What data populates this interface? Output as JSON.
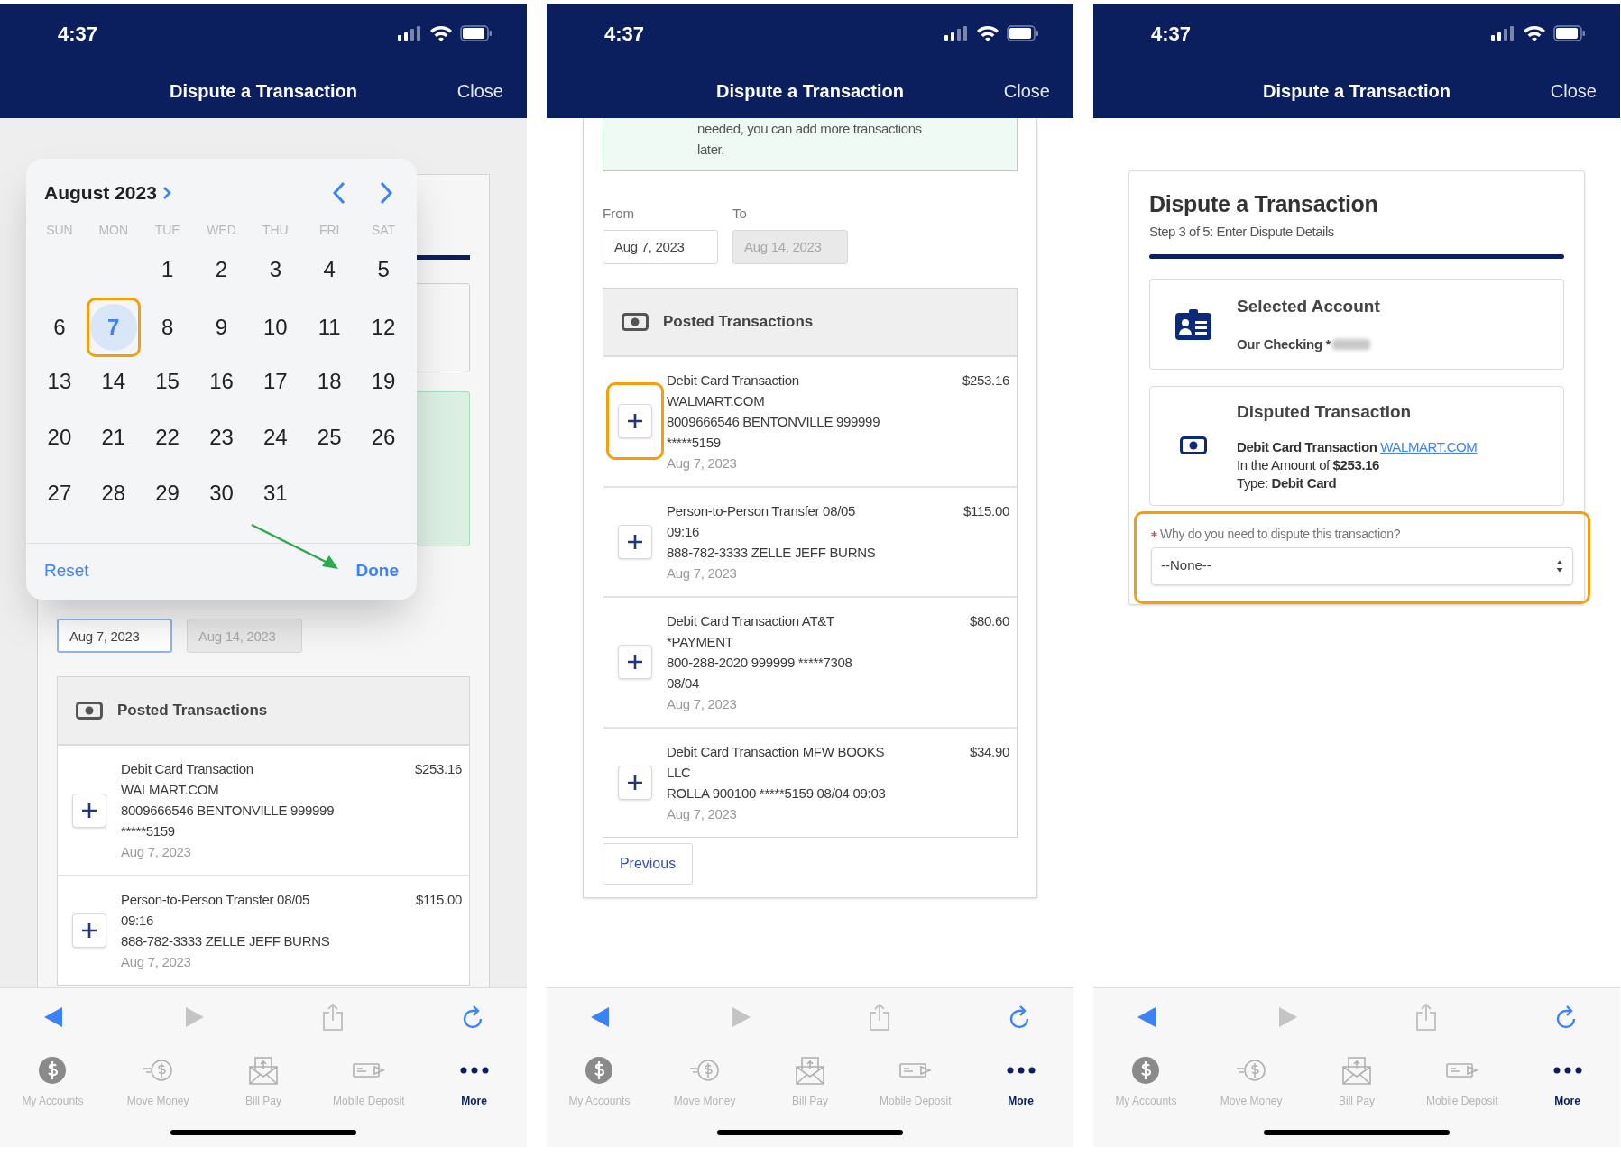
{
  "panels": [
    {
      "kind": "calendar",
      "status": {
        "time": "4:37"
      },
      "nav": {
        "title": "Dispute a Transaction",
        "close": "Close"
      },
      "calendar": {
        "month": "August 2023",
        "weekdays": [
          "SUN",
          "MON",
          "TUE",
          "WED",
          "THU",
          "FRI",
          "SAT"
        ],
        "weeks": [
          [
            {
              "kind": "blank"
            },
            {
              "kind": "blank"
            },
            {
              "kind": "day",
              "label": "1",
              "selected": false,
              "highlighted": false
            },
            {
              "kind": "day",
              "label": "2",
              "selected": false,
              "highlighted": false
            },
            {
              "kind": "day",
              "label": "3",
              "selected": false,
              "highlighted": false
            },
            {
              "kind": "day",
              "label": "4",
              "selected": false,
              "highlighted": false
            },
            {
              "kind": "day",
              "label": "5",
              "selected": false,
              "highlighted": false
            }
          ],
          [
            {
              "kind": "day",
              "label": "6",
              "selected": false,
              "highlighted": false
            },
            {
              "kind": "day",
              "label": "7",
              "selected": true,
              "highlighted": true
            },
            {
              "kind": "day",
              "label": "8",
              "selected": false,
              "highlighted": false
            },
            {
              "kind": "day",
              "label": "9",
              "selected": false,
              "highlighted": false
            },
            {
              "kind": "day",
              "label": "10",
              "selected": false,
              "highlighted": false
            },
            {
              "kind": "day",
              "label": "11",
              "selected": false,
              "highlighted": false
            },
            {
              "kind": "day",
              "label": "12",
              "selected": false,
              "highlighted": false
            }
          ],
          [
            {
              "kind": "day",
              "label": "13",
              "selected": false,
              "highlighted": false
            },
            {
              "kind": "day",
              "label": "14",
              "selected": false,
              "highlighted": false
            },
            {
              "kind": "day",
              "label": "15",
              "selected": false,
              "highlighted": false
            },
            {
              "kind": "day",
              "label": "16",
              "selected": false,
              "highlighted": false
            },
            {
              "kind": "day",
              "label": "17",
              "selected": false,
              "highlighted": false
            },
            {
              "kind": "day",
              "label": "18",
              "selected": false,
              "highlighted": false
            },
            {
              "kind": "day",
              "label": "19",
              "selected": false,
              "highlighted": false
            }
          ],
          [
            {
              "kind": "day",
              "label": "20",
              "selected": false,
              "highlighted": false
            },
            {
              "kind": "day",
              "label": "21",
              "selected": false,
              "highlighted": false
            },
            {
              "kind": "day",
              "label": "22",
              "selected": false,
              "highlighted": false
            },
            {
              "kind": "day",
              "label": "23",
              "selected": false,
              "highlighted": false
            },
            {
              "kind": "day",
              "label": "24",
              "selected": false,
              "highlighted": false
            },
            {
              "kind": "day",
              "label": "25",
              "selected": false,
              "highlighted": false
            },
            {
              "kind": "day",
              "label": "26",
              "selected": false,
              "highlighted": false
            }
          ],
          [
            {
              "kind": "day",
              "label": "27",
              "selected": false,
              "highlighted": false
            },
            {
              "kind": "day",
              "label": "28",
              "selected": false,
              "highlighted": false
            },
            {
              "kind": "day",
              "label": "29",
              "selected": false,
              "highlighted": false
            },
            {
              "kind": "day",
              "label": "30",
              "selected": false,
              "highlighted": false
            },
            {
              "kind": "day",
              "label": "31",
              "selected": false,
              "highlighted": false
            }
          ]
        ],
        "reset": "Reset",
        "done": "Done",
        "arrow_to_done": true
      },
      "date_fields": [
        {
          "value": "Aug 7, 2023",
          "focused": true,
          "disabled": false
        },
        {
          "value": "Aug 14, 2023",
          "focused": false,
          "disabled": true
        }
      ],
      "posted": {
        "title": "Posted Transactions",
        "transactions": [
          {
            "lines": [
              "Debit Card Transaction",
              "WALMART.COM",
              "8009666546 BENTONVILLE 999999",
              "*****5159"
            ],
            "amount": "$253.16",
            "date": "Aug 7, 2023",
            "highlighted": false
          },
          {
            "lines": [
              "Person-to-Person Transfer 08/05",
              "09:16",
              "888-782-3333 ZELLE JEFF BURNS"
            ],
            "amount": "$115.00",
            "date": "Aug 7, 2023",
            "highlighted": false
          }
        ]
      },
      "toolbar": [
        {
          "kind": "back",
          "enabled": true
        },
        {
          "kind": "forward",
          "enabled": false
        },
        {
          "kind": "share",
          "enabled": false
        },
        {
          "kind": "reload",
          "enabled": true
        }
      ],
      "tabs": [
        {
          "kind": "accounts",
          "label": "My Accounts",
          "selected": false
        },
        {
          "kind": "move",
          "label": "Move Money",
          "selected": false
        },
        {
          "kind": "bill",
          "label": "Bill Pay",
          "selected": false
        },
        {
          "kind": "deposit",
          "label": "Mobile Deposit",
          "selected": false
        },
        {
          "kind": "more",
          "label": "More",
          "selected": true
        }
      ]
    },
    {
      "kind": "list",
      "status": {
        "time": "4:37"
      },
      "nav": {
        "title": "Dispute a Transaction",
        "close": "Close"
      },
      "notice": {
        "lines": [
          "needed, you can add more transactions",
          "later."
        ]
      },
      "date_labels": [
        "From",
        "To"
      ],
      "date_fields": [
        {
          "value": "Aug 7, 2023",
          "focused": false,
          "disabled": false
        },
        {
          "value": "Aug 14, 2023",
          "focused": false,
          "disabled": true
        }
      ],
      "posted": {
        "title": "Posted Transactions",
        "transactions": [
          {
            "lines": [
              "Debit Card Transaction",
              "WALMART.COM",
              "8009666546 BENTONVILLE 999999",
              "*****5159"
            ],
            "amount": "$253.16",
            "date": "Aug 7, 2023",
            "highlighted": true
          },
          {
            "lines": [
              "Person-to-Person Transfer 08/05",
              "09:16",
              "888-782-3333 ZELLE JEFF BURNS"
            ],
            "amount": "$115.00",
            "date": "Aug 7, 2023",
            "highlighted": false
          },
          {
            "lines": [
              "Debit Card Transaction AT&T",
              "*PAYMENT",
              "800-288-2020 999999 *****7308",
              "08/04"
            ],
            "amount": "$80.60",
            "date": "Aug 7, 2023",
            "highlighted": false
          },
          {
            "lines": [
              "Debit Card Transaction MFW BOOKS",
              "LLC",
              "ROLLA 900100 *****5159 08/04 09:03"
            ],
            "amount": "$34.90",
            "date": "Aug 7, 2023",
            "highlighted": false
          }
        ]
      },
      "previous": "Previous",
      "toolbar": [
        {
          "kind": "back",
          "enabled": true
        },
        {
          "kind": "forward",
          "enabled": false
        },
        {
          "kind": "share",
          "enabled": false
        },
        {
          "kind": "reload",
          "enabled": true
        }
      ],
      "tabs": [
        {
          "kind": "accounts",
          "label": "My Accounts",
          "selected": false
        },
        {
          "kind": "move",
          "label": "Move Money",
          "selected": false
        },
        {
          "kind": "bill",
          "label": "Bill Pay",
          "selected": false
        },
        {
          "kind": "deposit",
          "label": "Mobile Deposit",
          "selected": false
        },
        {
          "kind": "more",
          "label": "More",
          "selected": true
        }
      ]
    },
    {
      "kind": "details",
      "status": {
        "time": "4:37"
      },
      "nav": {
        "title": "Dispute a Transaction",
        "close": "Close"
      },
      "card": {
        "title": "Dispute a Transaction",
        "step": "Step 3 of 5: Enter Dispute Details"
      },
      "account": {
        "title": "Selected Account",
        "value": "Our Checking *",
        "redacted": true
      },
      "disputed": {
        "title": "Disputed Transaction",
        "description": "Debit Card Transaction",
        "link": "WALMART.COM",
        "amount_line": "In the Amount of **$253.16**",
        "type_line": "Type: **Debit Card**"
      },
      "reason": {
        "label": "Why do you need to dispute this transaction?",
        "required": true,
        "value": "--None--",
        "highlighted": true
      },
      "toolbar": [
        {
          "kind": "back",
          "enabled": true
        },
        {
          "kind": "forward",
          "enabled": false
        },
        {
          "kind": "share",
          "enabled": false
        },
        {
          "kind": "reload",
          "enabled": true
        }
      ],
      "tabs": [
        {
          "kind": "accounts",
          "label": "My Accounts",
          "selected": false
        },
        {
          "kind": "move",
          "label": "Move Money",
          "selected": false
        },
        {
          "kind": "bill",
          "label": "Bill Pay",
          "selected": false
        },
        {
          "kind": "deposit",
          "label": "Mobile Deposit",
          "selected": false
        },
        {
          "kind": "more",
          "label": "More",
          "selected": true
        }
      ]
    }
  ]
}
